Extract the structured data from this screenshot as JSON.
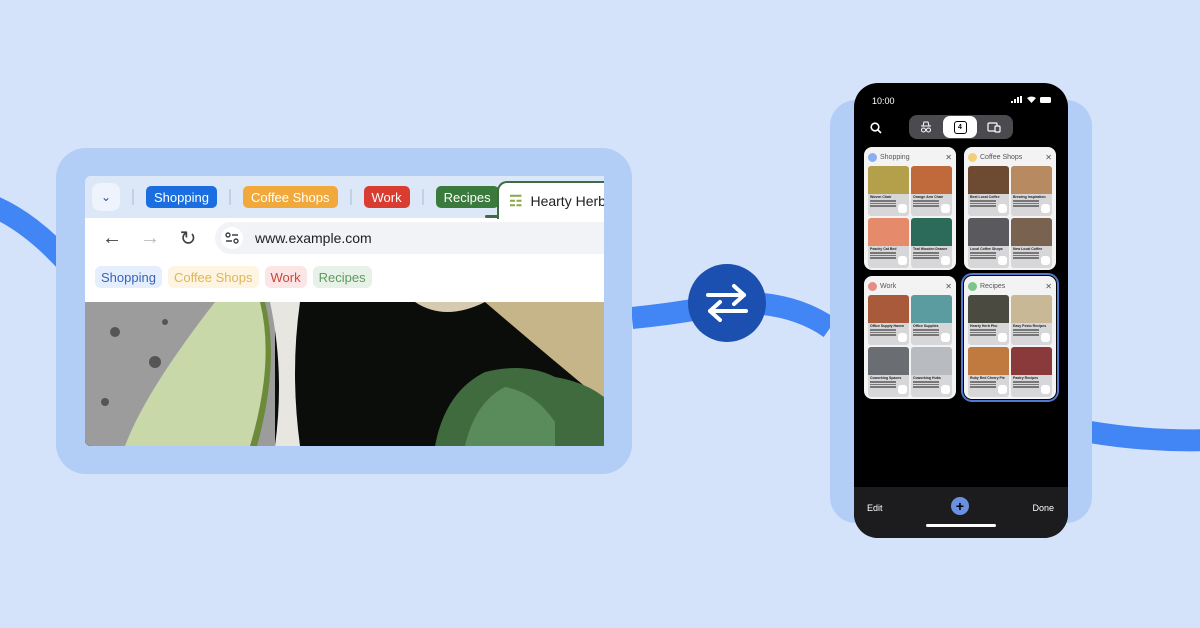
{
  "colors": {
    "background": "#d4e3f9",
    "frame": "#b2cdf6",
    "wave": "#4285f4",
    "swap_button": "#1b4fb0"
  },
  "browser": {
    "tab_groups": [
      {
        "label": "Shopping",
        "color": "#1a6ee0"
      },
      {
        "label": "Coffee Shops",
        "color": "#f2a93b"
      },
      {
        "label": "Work",
        "color": "#d93c31"
      },
      {
        "label": "Recipes",
        "color": "#3a7a3c"
      }
    ],
    "active_tab": {
      "title": "Hearty Herb",
      "icon": "herb-bowl-icon"
    },
    "url": "www.example.com",
    "bookmark_chips": [
      {
        "label": "Shopping",
        "bg": "#e5eefc",
        "fg": "#3a63b8"
      },
      {
        "label": "Coffee Shops",
        "bg": "#fdf5e2",
        "fg": "#e0b55a"
      },
      {
        "label": "Work",
        "bg": "#fbe6e5",
        "fg": "#c8473e"
      },
      {
        "label": "Recipes",
        "bg": "#e7f1e7",
        "fg": "#5d9b5f"
      }
    ]
  },
  "phone": {
    "time": "10:00",
    "tab_count": "4",
    "bottom": {
      "edit": "Edit",
      "done": "Done"
    },
    "groups": [
      {
        "title": "Shopping",
        "dot": "#8ab0ef",
        "selected": false,
        "tiles": [
          {
            "title": "Woven Chair",
            "img": "#b4a04a"
          },
          {
            "title": "Orange Arm Chair",
            "img": "#c06a3c"
          },
          {
            "title": "Peachy Cat Bed",
            "img": "#e58a6b"
          },
          {
            "title": "Teal Wooden Drawer",
            "img": "#2c6b5a"
          }
        ]
      },
      {
        "title": "Coffee Shops",
        "dot": "#f2d07a",
        "selected": false,
        "tiles": [
          {
            "title": "Best Local Coffee",
            "img": "#6d4a32"
          },
          {
            "title": "Brewing Inspiration",
            "img": "#b88a62"
          },
          {
            "title": "Local Coffee Shops",
            "img": "#5a5a5e"
          },
          {
            "title": "New Local Coffee",
            "img": "#7a6250"
          }
        ]
      },
      {
        "title": "Work",
        "dot": "#e58d86",
        "selected": false,
        "tiles": [
          {
            "title": "Office Supply Haven",
            "img": "#a85a3a"
          },
          {
            "title": "Office Supplies",
            "img": "#5a9ca0"
          },
          {
            "title": "Coworking Spaces",
            "img": "#6a6e72"
          },
          {
            "title": "Coworking Hubs",
            "img": "#b8bcc0"
          }
        ]
      },
      {
        "title": "Recipes",
        "dot": "#7cc48a",
        "selected": true,
        "tiles": [
          {
            "title": "Hearty Herb Pho",
            "img": "#4a4a40"
          },
          {
            "title": "Easy Pesto Recipes",
            "img": "#c8b896"
          },
          {
            "title": "Ruby Red Cherry Pie",
            "img": "#c07a40"
          },
          {
            "title": "Pastry Recipes",
            "img": "#8a3a3a"
          }
        ]
      }
    ]
  }
}
